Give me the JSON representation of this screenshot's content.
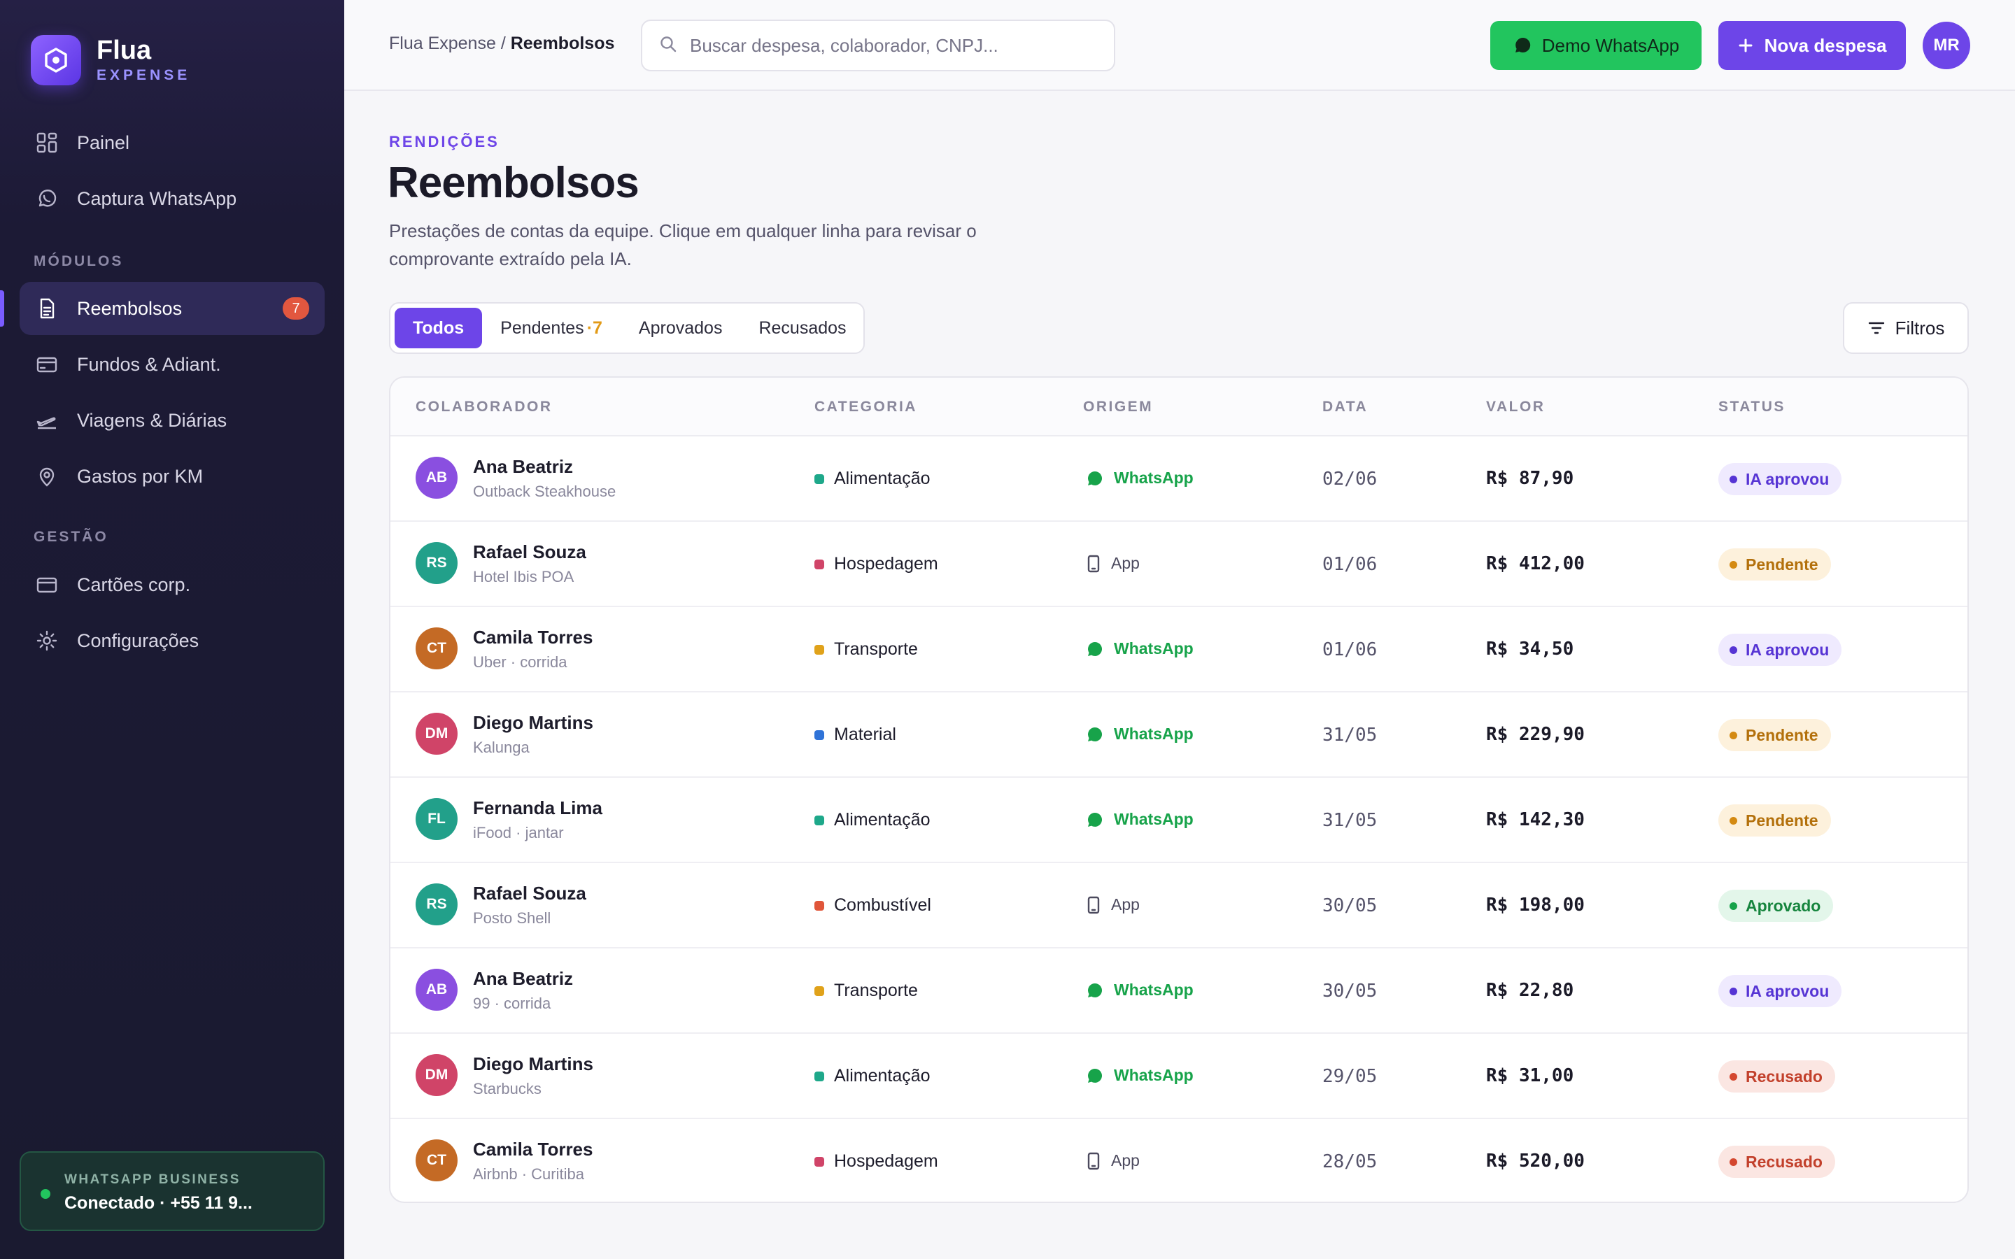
{
  "brand": {
    "name": "Flua",
    "sub": "EXPENSE"
  },
  "sidebar": {
    "top_items": [
      {
        "label": "Painel",
        "icon": "grid-icon"
      },
      {
        "label": "Captura WhatsApp",
        "icon": "whatsapp-icon"
      }
    ],
    "section_modules": "MÓDULOS",
    "module_items": [
      {
        "label": "Reembolsos",
        "icon": "document-icon",
        "badge": "7",
        "active": true
      },
      {
        "label": "Fundos & Adiant.",
        "icon": "wallet-icon"
      },
      {
        "label": "Viagens & Diárias",
        "icon": "plane-icon"
      },
      {
        "label": "Gastos por KM",
        "icon": "map-pin-icon"
      }
    ],
    "section_management": "GESTÃO",
    "management_items": [
      {
        "label": "Cartões corp.",
        "icon": "card-icon"
      },
      {
        "label": "Configurações",
        "icon": "gear-icon"
      }
    ],
    "whatsapp_status": {
      "title": "WHATSAPP BUSINESS",
      "line": "Conectado · +55 11 9..."
    }
  },
  "header": {
    "breadcrumb_root": "Flua Expense",
    "breadcrumb_sep": " / ",
    "breadcrumb_current": "Reembolsos",
    "search_placeholder": "Buscar despesa, colaborador, CNPJ...",
    "demo_whatsapp_label": "Demo WhatsApp",
    "new_expense_label": "Nova despesa",
    "user_initials": "MR"
  },
  "page": {
    "eyebrow": "RENDIÇÕES",
    "title": "Reembolsos",
    "description": "Prestações de contas da equipe. Clique em qualquer linha para revisar o comprovante extraído pela IA."
  },
  "tabs": [
    {
      "label": "Todos",
      "active": true
    },
    {
      "label": "Pendentes",
      "count": "·7"
    },
    {
      "label": "Aprovados"
    },
    {
      "label": "Recusados"
    }
  ],
  "filters_label": "Filtros",
  "table": {
    "columns": [
      "COLABORADOR",
      "CATEGORIA",
      "ORIGEM",
      "DATA",
      "VALOR",
      "STATUS"
    ],
    "rows": [
      {
        "initials": "AB",
        "avatar_color": "#8a4fe0",
        "name": "Ana Beatriz",
        "sub": "Outback Steakhouse",
        "category": "Alimentação",
        "cat_color": "#1ea88a",
        "origin": "WhatsApp",
        "origin_type": "wa",
        "date": "02/06",
        "value": "R$ 87,90",
        "status": "IA aprovou",
        "status_type": "ia"
      },
      {
        "initials": "RS",
        "avatar_color": "#22a08a",
        "name": "Rafael Souza",
        "sub": "Hotel Ibis POA",
        "category": "Hospedagem",
        "cat_color": "#d04468",
        "origin": "App",
        "origin_type": "app",
        "date": "01/06",
        "value": "R$ 412,00",
        "status": "Pendente",
        "status_type": "pend"
      },
      {
        "initials": "CT",
        "avatar_color": "#c46a25",
        "name": "Camila Torres",
        "sub": "Uber · corrida",
        "category": "Transporte",
        "cat_color": "#e0a21a",
        "origin": "WhatsApp",
        "origin_type": "wa",
        "date": "01/06",
        "value": "R$ 34,50",
        "status": "IA aprovou",
        "status_type": "ia"
      },
      {
        "initials": "DM",
        "avatar_color": "#d04468",
        "name": "Diego Martins",
        "sub": "Kalunga",
        "category": "Material",
        "cat_color": "#2f73d8",
        "origin": "WhatsApp",
        "origin_type": "wa",
        "date": "31/05",
        "value": "R$ 229,90",
        "status": "Pendente",
        "status_type": "pend"
      },
      {
        "initials": "FL",
        "avatar_color": "#22a08a",
        "name": "Fernanda Lima",
        "sub": "iFood · jantar",
        "category": "Alimentação",
        "cat_color": "#1ea88a",
        "origin": "WhatsApp",
        "origin_type": "wa",
        "date": "31/05",
        "value": "R$ 142,30",
        "status": "Pendente",
        "status_type": "pend"
      },
      {
        "initials": "RS",
        "avatar_color": "#22a08a",
        "name": "Rafael Souza",
        "sub": "Posto Shell",
        "category": "Combustível",
        "cat_color": "#e0563a",
        "origin": "App",
        "origin_type": "app",
        "date": "30/05",
        "value": "R$ 198,00",
        "status": "Aprovado",
        "status_type": "ok"
      },
      {
        "initials": "AB",
        "avatar_color": "#8a4fe0",
        "name": "Ana Beatriz",
        "sub": "99 · corrida",
        "category": "Transporte",
        "cat_color": "#e0a21a",
        "origin": "WhatsApp",
        "origin_type": "wa",
        "date": "30/05",
        "value": "R$ 22,80",
        "status": "IA aprovou",
        "status_type": "ia"
      },
      {
        "initials": "DM",
        "avatar_color": "#d04468",
        "name": "Diego Martins",
        "sub": "Starbucks",
        "category": "Alimentação",
        "cat_color": "#1ea88a",
        "origin": "WhatsApp",
        "origin_type": "wa",
        "date": "29/05",
        "value": "R$ 31,00",
        "status": "Recusado",
        "status_type": "rej"
      },
      {
        "initials": "CT",
        "avatar_color": "#c46a25",
        "name": "Camila Torres",
        "sub": "Airbnb · Curitiba",
        "category": "Hospedagem",
        "cat_color": "#d04468",
        "origin": "App",
        "origin_type": "app",
        "date": "28/05",
        "value": "R$ 520,00",
        "status": "Recusado",
        "status_type": "rej"
      }
    ]
  }
}
